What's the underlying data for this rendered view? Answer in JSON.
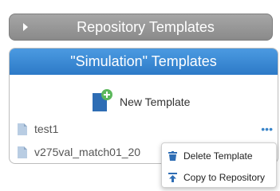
{
  "repository": {
    "title": "Repository Templates"
  },
  "panel": {
    "title": "\"Simulation\" Templates",
    "new_template_label": "New Template",
    "items": [
      {
        "name": "test1"
      },
      {
        "name": "v275val_match01_20"
      }
    ]
  },
  "context_menu": {
    "items": [
      {
        "label": "Delete Template",
        "icon": "trash-icon"
      },
      {
        "label": "Copy to Repository",
        "icon": "upload-icon"
      }
    ]
  },
  "more_glyph": "•••",
  "colors": {
    "header_blue": "#3a8ad6",
    "header_gray": "#999999",
    "accent": "#2e6db4"
  }
}
